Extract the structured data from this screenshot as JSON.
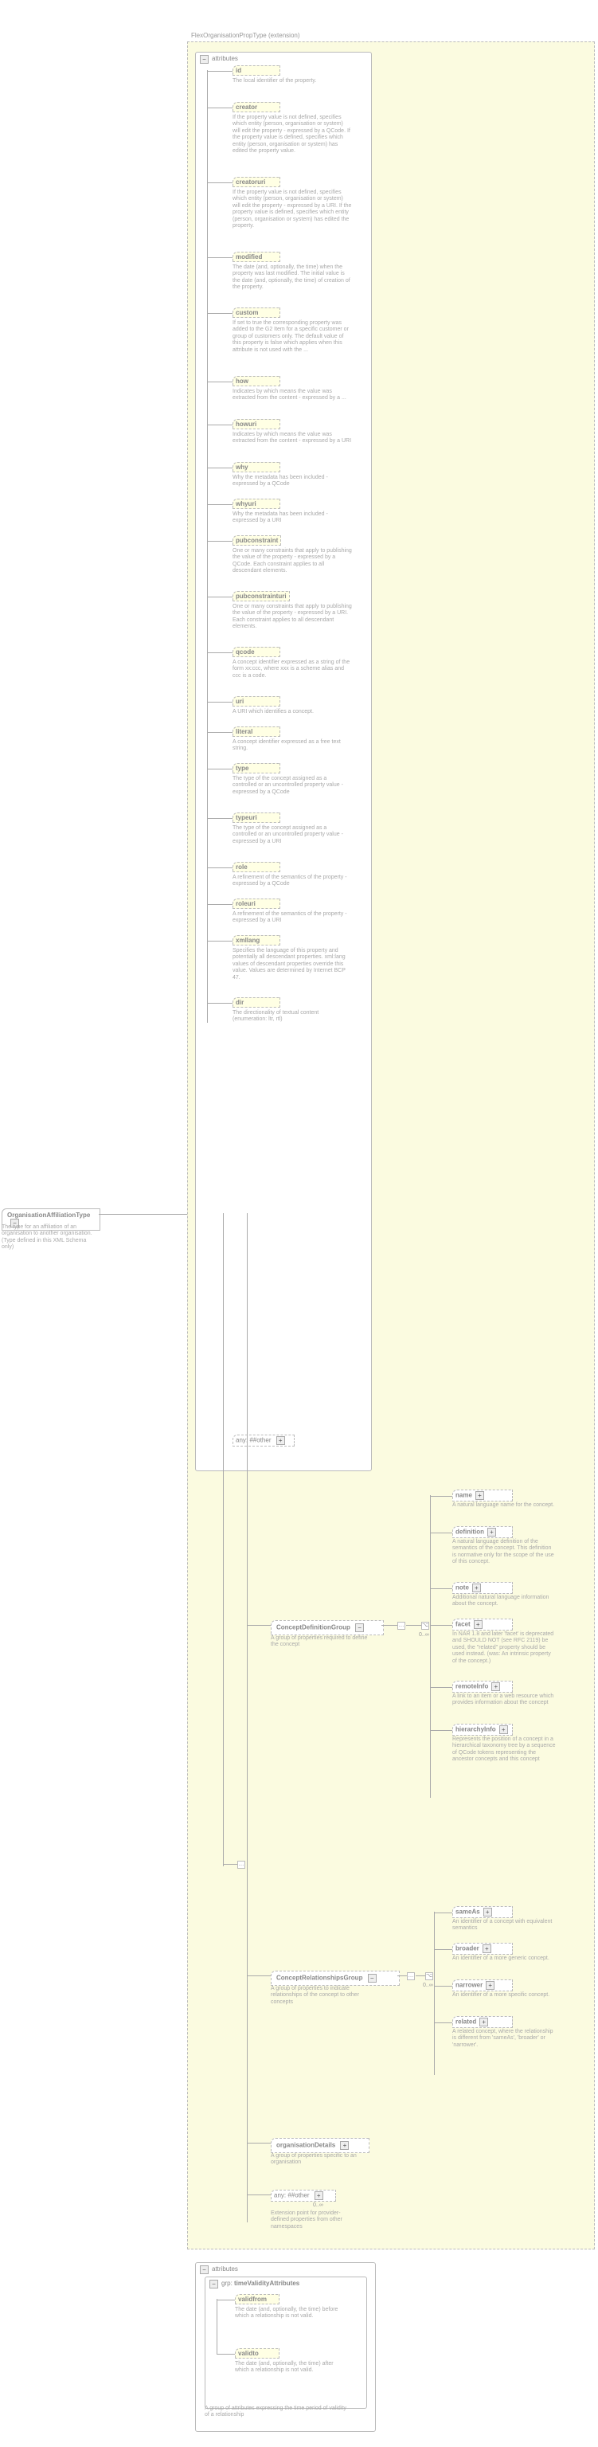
{
  "root": {
    "name": "OrganisationAffiliationType",
    "desc": "The type for an affiliation of an organisation to another organisation. (Type defined in this XML Schema only)",
    "expand": "−"
  },
  "ext": {
    "label": "FlexOrganisationPropType (extension)",
    "attributes_label": "attributes",
    "expand": "−",
    "attributes": [
      {
        "name": "id",
        "desc": "The local identifier of the property."
      },
      {
        "name": "creator",
        "desc": "If the property value is not defined, specifies which entity (person, organisation or system) will edit the property - expressed by a QCode. If the property value is defined, specifies which entity (person, organisation or system) has edited the property value."
      },
      {
        "name": "creatoruri",
        "desc": "If the property value is not defined, specifies which entity (person, organisation or system) will edit the property - expressed by a URI. If the property value is defined, specifies which entity (person, organisation or system) has edited the property."
      },
      {
        "name": "modified",
        "desc": "The date (and, optionally, the time) when the property was last modified. The initial value is the date (and, optionally, the time) of creation of the property."
      },
      {
        "name": "custom",
        "desc": "If set to true the corresponding property was added to the G2 Item for a specific customer or group of customers only. The default value of this property is false which applies when this attribute is not used with the ..."
      },
      {
        "name": "how",
        "desc": "Indicates by which means the value was extracted from the content - expressed by a ..."
      },
      {
        "name": "howuri",
        "desc": "Indicates by which means the value was extracted from the content - expressed by a URI"
      },
      {
        "name": "why",
        "desc": "Why the metadata has been included - expressed by a QCode"
      },
      {
        "name": "whyuri",
        "desc": "Why the metadata has been included - expressed by a URI"
      },
      {
        "name": "pubconstraint",
        "desc": "One or many constraints that apply to publishing the value of the property - expressed by a QCode. Each constraint applies to all descendant elements."
      },
      {
        "name": "pubconstrainturi",
        "desc": "One or many constraints that apply to publishing the value of the property - expressed by a URI. Each constraint applies to all descendant elements."
      },
      {
        "name": "qcode",
        "desc": "A concept identifier expressed as a string of the form xx:ccc, where xxx is a scheme alias and ccc is a code."
      },
      {
        "name": "uri",
        "desc": "A URI which identifies a concept."
      },
      {
        "name": "literal",
        "desc": "A concept identifier expressed as a free text string."
      },
      {
        "name": "type",
        "desc": "The type of the concept assigned as a controlled or an uncontrolled property value - expressed by a QCode"
      },
      {
        "name": "typeuri",
        "desc": "The type of the concept assigned as a controlled or an uncontrolled property value - expressed by a URI"
      },
      {
        "name": "role",
        "desc": "A refinement of the semantics of the property - expressed by a QCode"
      },
      {
        "name": "roleuri",
        "desc": "A refinement of the semantics of the property - expressed by a URI"
      },
      {
        "name": "xmllang",
        "desc": "Specifies the language of this property and potentially all descendant properties. xml:lang values of descendant properties override this value. Values are determined by Internet BCP 47."
      },
      {
        "name": "dir",
        "desc": "The directionality of textual content (enumeration: ltr, rtl)"
      }
    ],
    "other": {
      "label": "any: ##other",
      "expand": "+"
    }
  },
  "cdg": {
    "name": "ConceptDefinitionGroup",
    "desc": "A group of properties required to define the concept",
    "occ": "0..∞",
    "expand": "−",
    "children": [
      {
        "name": "name",
        "desc": "A natural language name for the concept.",
        "exp": "+"
      },
      {
        "name": "definition",
        "desc": "A natural language definition of the semantics of the concept. This definition is normative only for the scope of the use of this concept.",
        "exp": "+"
      },
      {
        "name": "note",
        "desc": "Additional natural language information about the concept.",
        "exp": "+"
      },
      {
        "name": "facet",
        "desc": "In NAR 1.8 and later 'facet' is deprecated and SHOULD NOT (see RFC 2119) be used, the \"related\" property should be used instead. (was: An intrinsic property of the concept.)",
        "exp": "+"
      },
      {
        "name": "remoteInfo",
        "desc": "A link to an item or a web resource which provides information about the concept",
        "exp": "+"
      },
      {
        "name": "hierarchyInfo",
        "desc": "Represents the position of a concept in a hierarchical taxonomy tree by a sequence of QCode tokens representing the ancestor concepts and this concept",
        "exp": "+"
      }
    ]
  },
  "crg": {
    "name": "ConceptRelationshipsGroup",
    "desc": "A group of properties to indicate relationships of the concept to other concepts",
    "occ": "0..∞",
    "expand": "−",
    "children": [
      {
        "name": "sameAs",
        "desc": "An identifier of a concept with equivalent semantics",
        "exp": "+"
      },
      {
        "name": "broader",
        "desc": "An identifier of a more generic concept.",
        "exp": "+"
      },
      {
        "name": "narrower",
        "desc": "An identifier of a more specific concept.",
        "exp": "+"
      },
      {
        "name": "related",
        "desc": "A related concept, where the relationship is different from 'sameAs', 'broader' or 'narrower'.",
        "exp": "+"
      }
    ]
  },
  "orgd": {
    "name": "organisationDetails",
    "desc": "A group of properties specific to an organisation",
    "expand": "+"
  },
  "any2": {
    "label": "any: ##other",
    "occ": "0..∞",
    "desc": "Extension point for provider-defined properties from other namespaces",
    "expand": "+"
  },
  "tva": {
    "panel_label": "attributes",
    "group_label": "grp: timeValidityAttributes",
    "expand": "−",
    "attrs": [
      {
        "name": "validfrom",
        "desc": "The date (and, optionally, the time) before which a relationship is not valid."
      },
      {
        "name": "validto",
        "desc": "The date (and, optionally, the time) after which a relationship is not valid."
      }
    ],
    "desc": "A group of attributes expressing the time period of validity of a relationship"
  }
}
